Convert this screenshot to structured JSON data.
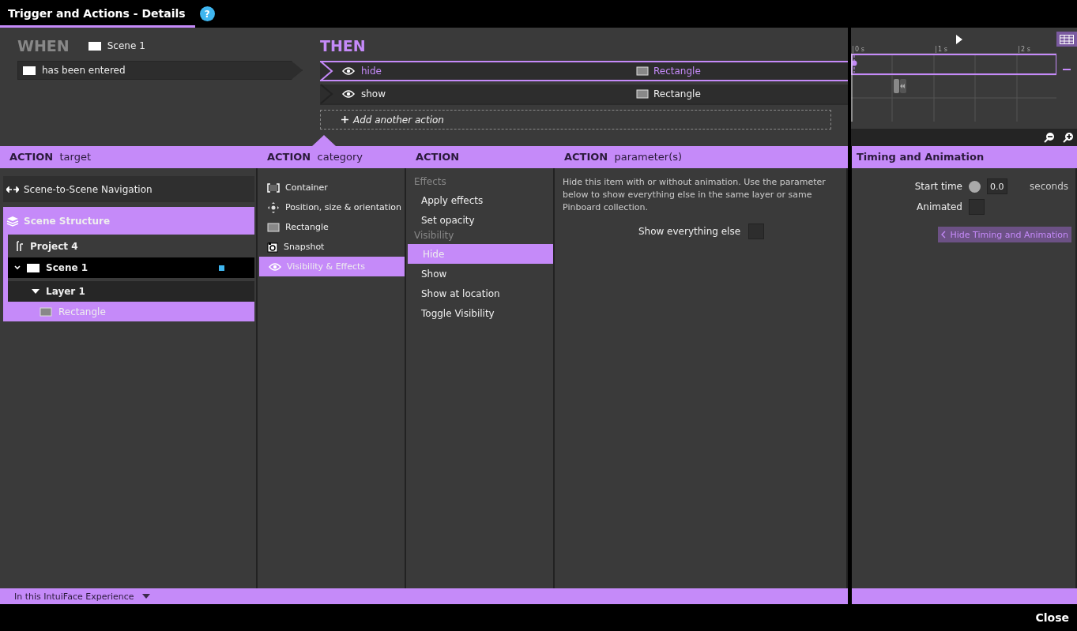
{
  "window": {
    "title": "Trigger and Actions - Details",
    "help": "?"
  },
  "when": {
    "heading": "WHEN",
    "scene": "Scene 1",
    "trigger": "has been entered"
  },
  "then": {
    "heading": "THEN",
    "add_label": "Add another action",
    "actions": [
      {
        "name": "hide",
        "target": "Rectangle",
        "selected": true
      },
      {
        "name": "show",
        "target": "Rectangle",
        "selected": false
      }
    ]
  },
  "timeline": {
    "ticks": [
      "0 s",
      "1 s",
      "2 s"
    ]
  },
  "headers": [
    {
      "strong": "ACTION",
      "rest": "target"
    },
    {
      "strong": "ACTION",
      "rest": "category"
    },
    {
      "strong": "ACTION"
    },
    {
      "strong": "ACTION",
      "rest": "parameter(s)"
    }
  ],
  "target": {
    "navigation": "Scene-to-Scene Navigation",
    "structure": {
      "label": "Scene Structure",
      "selected": true
    },
    "tree": [
      {
        "label": "Project 4",
        "kind": "project",
        "selected": false,
        "children": [
          {
            "label": "Scene 1",
            "kind": "scene",
            "expanded": true,
            "selected": false,
            "children": [
              {
                "label": "Layer 1",
                "kind": "layer",
                "expanded": true,
                "selected": false,
                "children": [
                  {
                    "label": "Rectangle",
                    "kind": "rectangle",
                    "selected": true
                  }
                ]
              }
            ]
          }
        ]
      }
    ]
  },
  "categories": [
    {
      "label": "Container",
      "kind": "container",
      "selected": false
    },
    {
      "label": "Position, size & orientation",
      "kind": "position",
      "selected": false
    },
    {
      "label": "Rectangle",
      "kind": "rectangle",
      "selected": false
    },
    {
      "label": "Snapshot",
      "kind": "snapshot",
      "selected": false
    },
    {
      "label": "Visibility & Effects",
      "kind": "eye",
      "selected": true
    }
  ],
  "action_groups": [
    {
      "heading": "Effects",
      "items": [
        {
          "label": "Apply effects",
          "selected": false
        },
        {
          "label": "Set opacity",
          "selected": false
        }
      ]
    },
    {
      "heading": "Visibility",
      "items": [
        {
          "label": "Hide",
          "selected": true
        },
        {
          "label": "Show",
          "selected": false
        },
        {
          "label": "Show at location",
          "selected": false
        },
        {
          "label": "Toggle Visibility",
          "selected": false
        }
      ]
    }
  ],
  "parameters": {
    "description": "Hide this item with or without animation. Use the parameter below to show everything else in the same layer or same Pinboard collection.",
    "option": {
      "label": "Show everything else",
      "checked": false
    }
  },
  "timing": {
    "heading": "Timing and Animation",
    "start_label": "Start time",
    "start_value": "0.0",
    "start_selected": false,
    "unit": "seconds",
    "animated_label": "Animated",
    "animated": false,
    "button": "Hide Timing and Animation"
  },
  "footer": {
    "scope": "In this IntuiFace Experience",
    "close": "Close"
  }
}
